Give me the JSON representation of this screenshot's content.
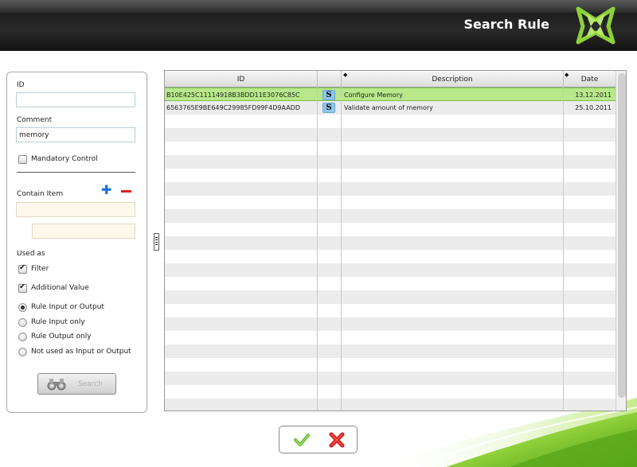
{
  "header": {
    "title": "Search Rule"
  },
  "form": {
    "id_label": "ID",
    "id_value": "",
    "comment_label": "Comment",
    "comment_value": "memory",
    "mandatory_label": "Mandatory Control",
    "mandatory_checked": false,
    "contain_item_label": "Contain Item",
    "contain_item_value": "",
    "contain_item_value2": "",
    "used_as_label": "Used as",
    "filter_label": "Filter",
    "filter_checked": true,
    "additional_label": "Additional Value",
    "additional_checked": true,
    "radio_options": [
      "Rule Input or Output",
      "Rule Input only",
      "Rule Output only",
      "Not used as Input or Output"
    ],
    "radio_selected": "Rule Input or Output",
    "search_label": "Search"
  },
  "table": {
    "columns": {
      "id": "ID",
      "description": "Description",
      "date": "Date"
    },
    "rows": [
      {
        "id": "B10E425C11114918B3BDD11E3076C85C",
        "type": "S",
        "description": "Configure Memory",
        "date": "13.12.2011",
        "selected": true
      },
      {
        "id": "6563765E9BE649C29985FD99F4D9AADD",
        "type": "S",
        "description": "Validate amount of memory",
        "date": "25.10.2011",
        "selected": false
      }
    ]
  },
  "icons": {
    "logo": "logo-icon",
    "add": "plus-icon",
    "remove": "minus-icon",
    "search": "binoculars-icon",
    "ok": "checkmark-icon",
    "cancel": "x-icon"
  },
  "colors": {
    "selected_row": "#b8e88a",
    "accent_green": "#7cc242",
    "badge_blue": "#8fc6ee",
    "add_blue": "#1a6fd6",
    "remove_red": "#e0201a"
  }
}
